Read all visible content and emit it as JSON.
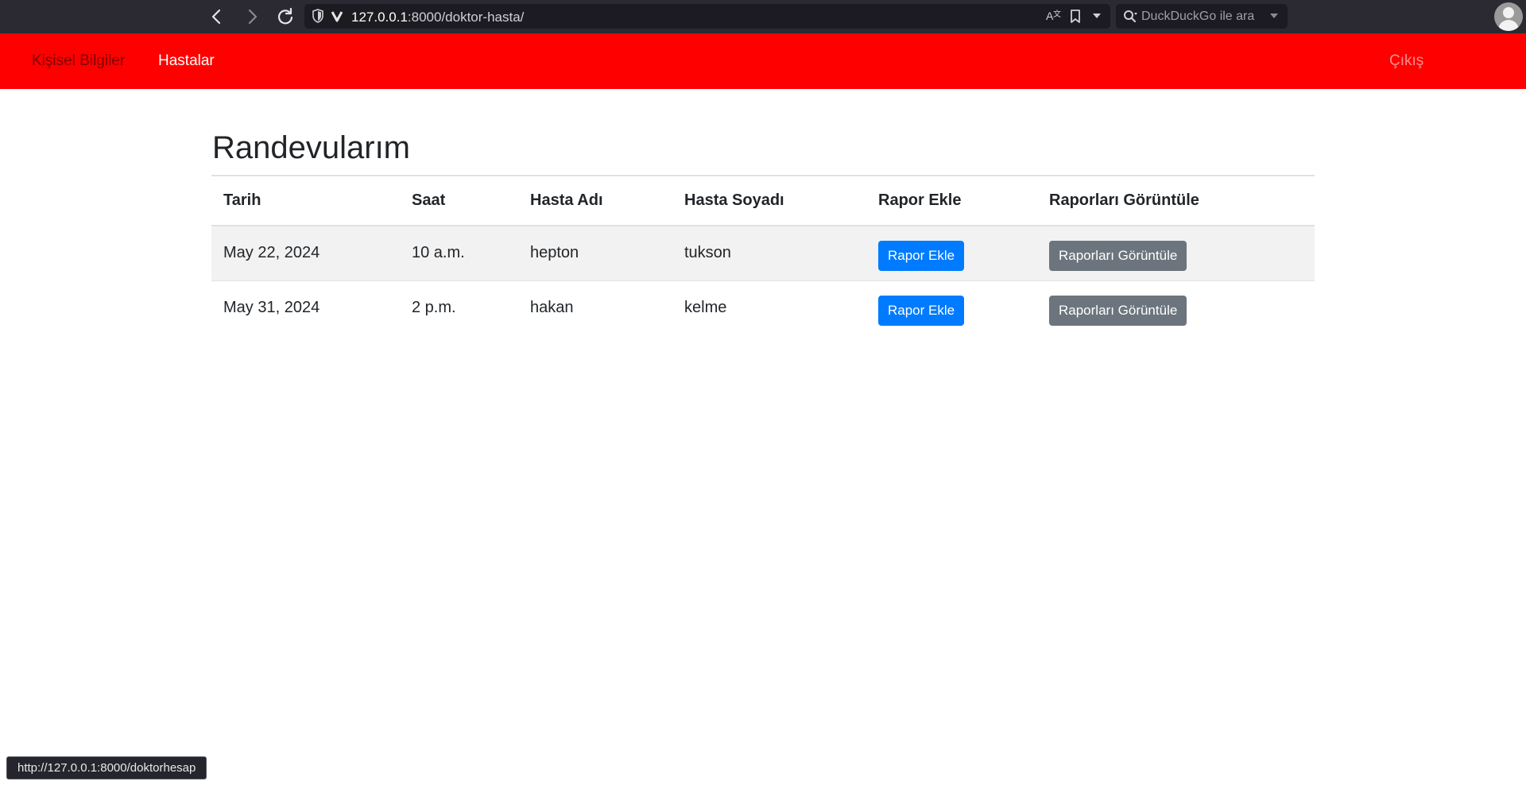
{
  "browser": {
    "url_host": "127.0.0.1",
    "url_path": ":8000/doktor-hasta/",
    "search_placeholder": "DuckDuckGo ile ara",
    "status_url": "http://127.0.0.1:8000/doktorhesap",
    "icons": [
      "back-arrow-icon",
      "forward-arrow-icon",
      "reload-icon",
      "shield-icon",
      "vivaldi-icon",
      "translate-icon",
      "bookmark-icon",
      "dropdown-icon",
      "search-icon",
      "avatar-icon"
    ]
  },
  "navbar": {
    "background_color": "#ff0000",
    "items": [
      {
        "label": "Kişisel Bilgiler"
      },
      {
        "label": "Hastalar"
      }
    ],
    "logout_label": "Çıkış"
  },
  "main": {
    "title": "Randevularım",
    "table": {
      "headers": [
        "Tarih",
        "Saat",
        "Hasta Adı",
        "Hasta Soyadı",
        "Rapor Ekle",
        "Raporları Görüntüle"
      ],
      "rows": [
        {
          "date": "May 22, 2024",
          "time": "10 a.m.",
          "first_name": "hepton",
          "last_name": "tukson",
          "add_label": "Rapor Ekle",
          "view_label": "Raporları Görüntüle"
        },
        {
          "date": "May 31, 2024",
          "time": "2 p.m.",
          "first_name": "hakan",
          "last_name": "kelme",
          "add_label": "Rapor Ekle",
          "view_label": "Raporları Görüntüle"
        }
      ]
    }
  },
  "colors": {
    "primary_button": "#007bff",
    "secondary_button": "#6c757d",
    "striped_row": "#f2f2f2"
  }
}
